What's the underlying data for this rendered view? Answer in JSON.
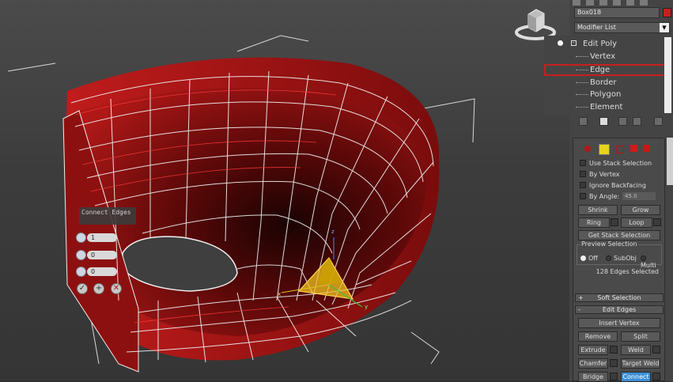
{
  "object": {
    "name": "Box018",
    "color": "#c42020"
  },
  "modifier_list": {
    "label": "Modifier List"
  },
  "stack": {
    "items": [
      {
        "label": "Edit Poly",
        "top": true
      },
      {
        "label": "Vertex"
      },
      {
        "label": "Edge",
        "selected": true
      },
      {
        "label": "Border"
      },
      {
        "label": "Polygon"
      },
      {
        "label": "Element"
      }
    ]
  },
  "selection": {
    "use_stack_selection": "Use Stack Selection",
    "by_vertex": "By Vertex",
    "ignore_backfacing": "Ignore Backfacing",
    "by_angle": "By Angle:",
    "by_angle_value": "45.0",
    "shrink": "Shrink",
    "grow": "Grow",
    "ring": "Ring",
    "loop": "Loop",
    "get_stack_selection": "Get Stack Selection",
    "preview_title": "Preview Selection",
    "preview_off": "Off",
    "preview_subobj": "SubObj",
    "preview_multi": "Multi",
    "status": "128 Edges Selected"
  },
  "soft_selection": {
    "label": "Soft Selection",
    "sign": "+"
  },
  "edit_edges": {
    "label": "Edit Edges",
    "sign": "-",
    "insert_vertex": "Insert Vertex",
    "remove": "Remove",
    "split": "Split",
    "extrude": "Extrude",
    "weld": "Weld",
    "chamfer": "Chamfer",
    "target_weld": "Target Weld",
    "bridge": "Bridge",
    "connect": "Connect"
  },
  "caddy": {
    "title": "Connect Edges",
    "segments": "1",
    "pinch": "0",
    "slide": "0",
    "ok": "✓",
    "apply": "+",
    "cancel": "✕"
  },
  "gizmo": {
    "x_label": "x",
    "y_label": "y",
    "z_label": "z"
  },
  "colors": {
    "accent": "#3c8fd6",
    "selection_outline": "#c81e1e",
    "mesh_red": "#a01010",
    "gizmo_yellow": "#f0c020"
  }
}
